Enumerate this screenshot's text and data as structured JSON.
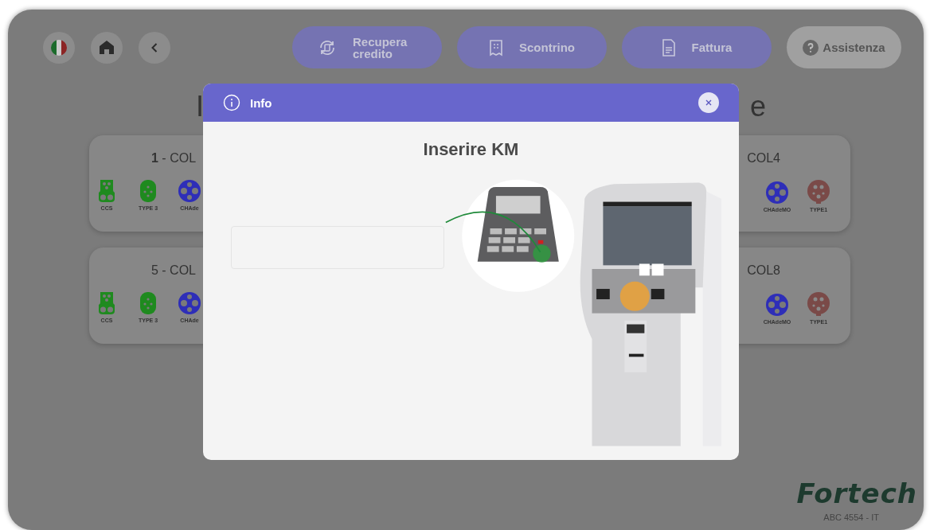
{
  "top_bar": {
    "nav_buttons": [
      {
        "kind": "flag"
      },
      {
        "kind": "home"
      },
      {
        "kind": "back"
      }
    ],
    "actions": [
      {
        "label": "Recupera credito",
        "kind": "refund"
      },
      {
        "label": "Scontrino",
        "kind": "receipt"
      },
      {
        "label": "Fattura",
        "kind": "invoice"
      }
    ],
    "help": {
      "label": "Assistenza"
    }
  },
  "heading": {
    "left_fragment": "I",
    "right_fragment": "e"
  },
  "cards": [
    {
      "title": "**1** - COL",
      "connectors": [
        {
          "label": "CCS",
          "kind": "ccs"
        },
        {
          "label": "TYPE 3",
          "kind": "type3"
        },
        {
          "label": "CHAde",
          "kind": "chademo"
        }
      ]
    },
    {
      "title": "COL4",
      "connectors": [
        {
          "label": "CHAdeMO",
          "kind": "chademo"
        },
        {
          "label": "TYPE1",
          "kind": "type1"
        }
      ]
    },
    {
      "title": "5 - COL",
      "connectors": [
        {
          "label": "CCS",
          "kind": "ccs"
        },
        {
          "label": "TYPE 3",
          "kind": "type3"
        },
        {
          "label": "CHAde",
          "kind": "chademo"
        }
      ]
    },
    {
      "title": "COL8",
      "connectors": [
        {
          "label": "CHAdeMO",
          "kind": "chademo"
        },
        {
          "label": "TYPE1",
          "kind": "type1"
        }
      ]
    }
  ],
  "modal": {
    "title": "Info",
    "heading": "Inserire KM"
  },
  "footer": {
    "logo": "Fortech",
    "plate": "ABC 4554 - IT"
  }
}
